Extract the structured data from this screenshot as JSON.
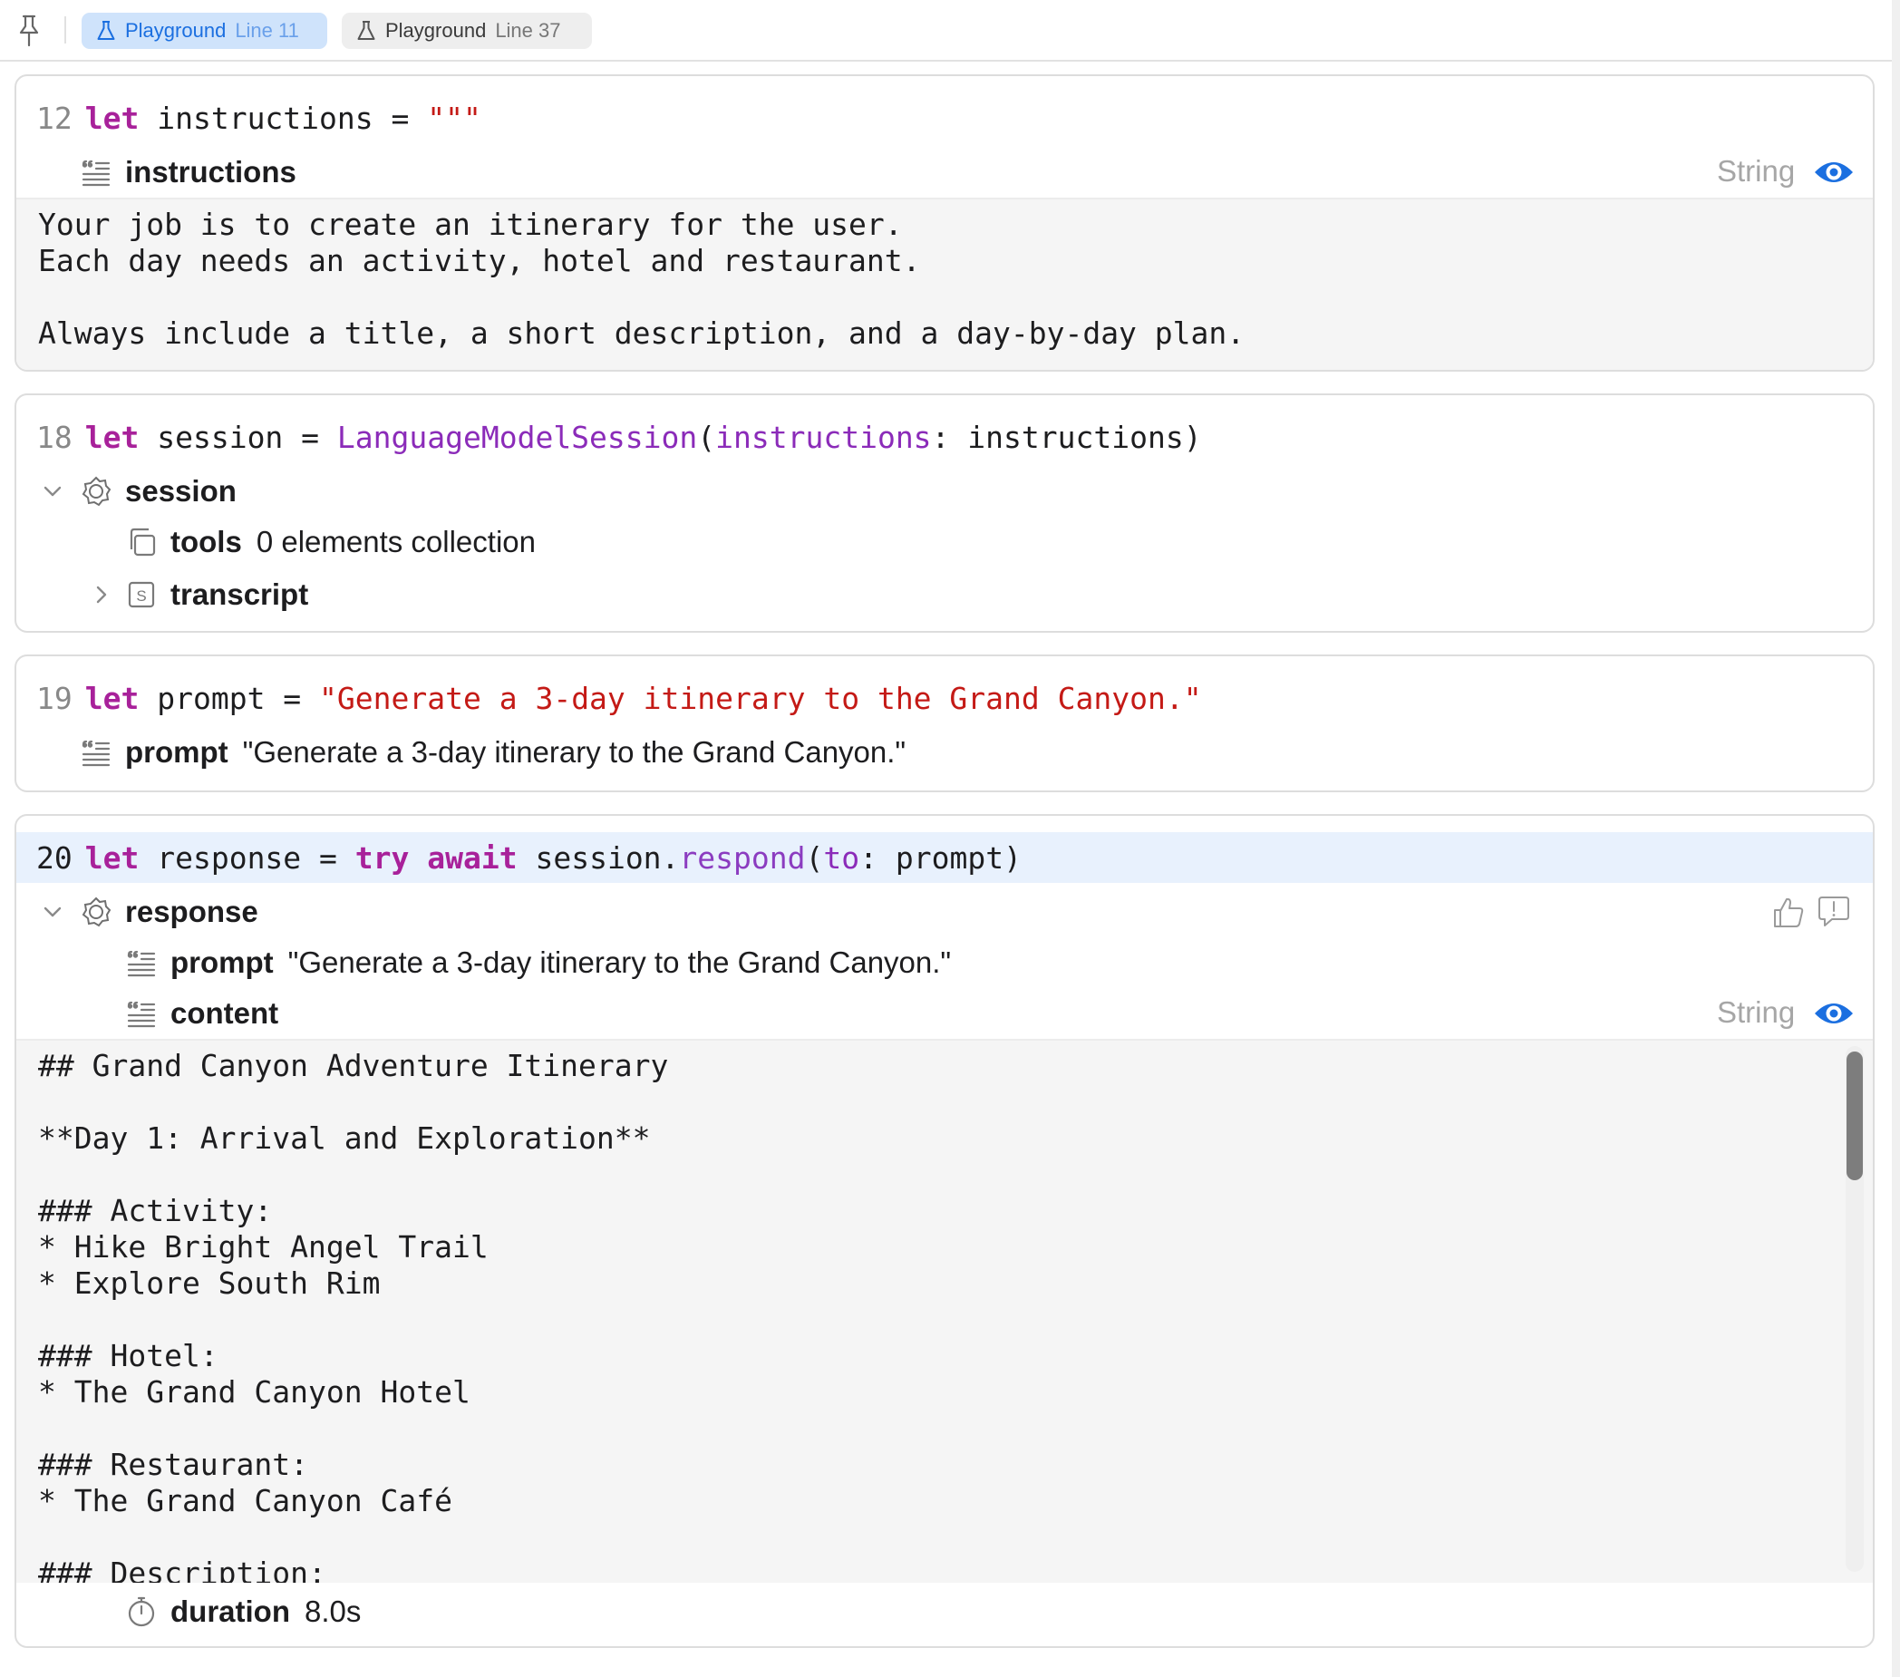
{
  "tabs": [
    {
      "title": "Playground",
      "line": "Line 11",
      "active": true
    },
    {
      "title": "Playground",
      "line": "Line 37",
      "active": false
    }
  ],
  "colors": {
    "accent": "#1b6fe0",
    "keyword": "#a8219a",
    "string": "#c41a16",
    "type": "#8b2bb9"
  },
  "cells": {
    "instructions": {
      "line_number": "12",
      "code": {
        "kw": "let",
        "rest": " instructions = ",
        "str": "\"\"\""
      },
      "result_name": "instructions",
      "result_type": "String",
      "text_lines": [
        "Your job is to create an itinerary for the user.",
        "Each day needs an activity, hotel and restaurant.",
        "",
        "Always include a title, a short description, and a day-by-day plan."
      ]
    },
    "session": {
      "line_number": "18",
      "code": {
        "kw": "let",
        "name": " session = ",
        "type": "LanguageModelSession",
        "open": "(",
        "param": "instructions",
        "rest": ": instructions)"
      },
      "result_name": "session",
      "children": [
        {
          "name": "tools",
          "value": "0 elements collection"
        },
        {
          "name": "transcript",
          "value": ""
        }
      ]
    },
    "prompt": {
      "line_number": "19",
      "code": {
        "kw": "let",
        "rest": " prompt = ",
        "str": "\"Generate a 3-day itinerary to the Grand Canyon.\""
      },
      "result_name": "prompt",
      "result_value": "\"Generate a 3-day itinerary to the Grand Canyon.\""
    },
    "response": {
      "line_number": "20",
      "code": {
        "kw": "let",
        "name": " response = ",
        "kw2": "try",
        "sp": " ",
        "kw3": "await",
        "obj": " session.",
        "method": "respond",
        "open": "(",
        "param": "to",
        "rest": ": prompt)"
      },
      "result_name": "response",
      "prompt_name": "prompt",
      "prompt_value": "\"Generate a 3-day itinerary to the Grand Canyon.\"",
      "content_name": "content",
      "content_type": "String",
      "content_lines": [
        "## Grand Canyon Adventure Itinerary",
        "",
        "**Day 1: Arrival and Exploration**",
        "",
        "### Activity:",
        "* Hike Bright Angel Trail",
        "* Explore South Rim",
        "",
        "### Hotel:",
        "* The Grand Canyon Hotel",
        "",
        "### Restaurant:",
        "* The Grand Canyon Café",
        "",
        "### Description:"
      ],
      "duration_name": "duration",
      "duration_value": "8.0s"
    }
  },
  "icons": {
    "pin": "pin-icon",
    "tab": "flask-icon",
    "string_result": "quote-list-icon",
    "object_result": "model-session-icon",
    "collection": "collection-icon",
    "struct": "struct-s-icon",
    "timer": "stopwatch-icon",
    "quick_look": "eye-icon",
    "feedback_positive": "thumbs-up-icon",
    "feedback_report": "feedback-bubble-icon"
  }
}
